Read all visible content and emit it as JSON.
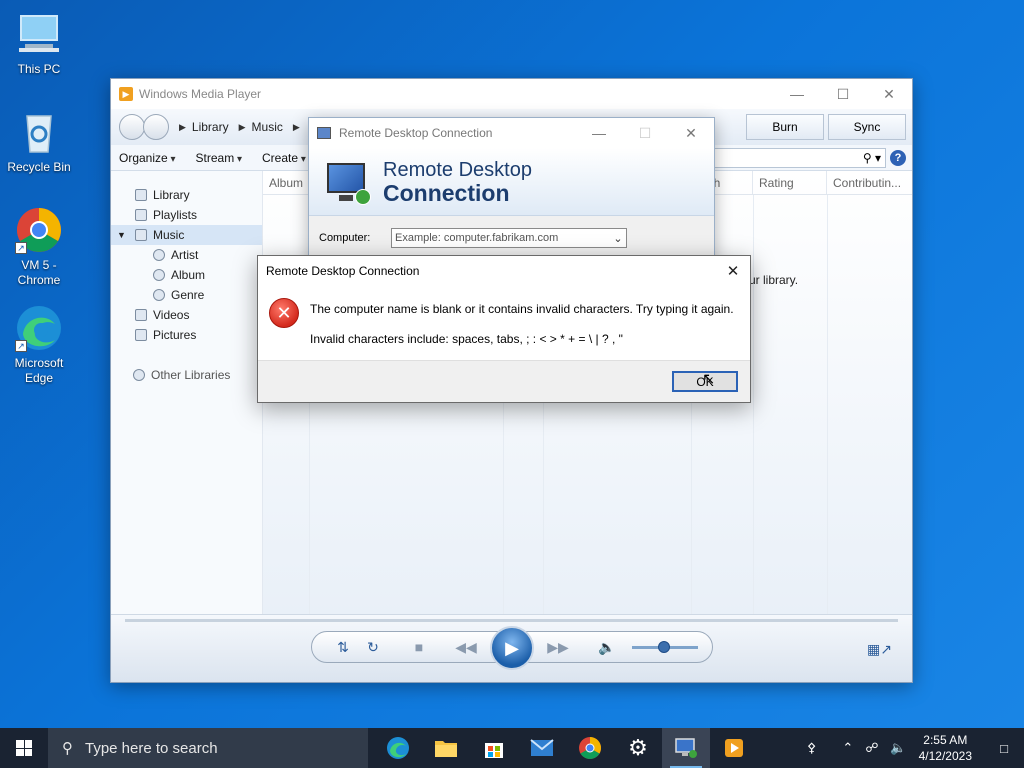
{
  "desktop": {
    "icons": [
      {
        "label": "This PC"
      },
      {
        "label": "Recycle Bin"
      },
      {
        "label": "VM 5 - Chrome"
      },
      {
        "label": "Microsoft Edge"
      }
    ]
  },
  "wmp": {
    "title": "Windows Media Player",
    "breadcrumb": [
      "Library",
      "Music"
    ],
    "top_buttons": [
      "Burn",
      "Sync"
    ],
    "toolbar": [
      "Organize",
      "Stream",
      "Create"
    ],
    "sidebar": [
      {
        "label": "Library"
      },
      {
        "label": "Playlists"
      },
      {
        "label": "Music"
      },
      {
        "label": "Artist"
      },
      {
        "label": "Album"
      },
      {
        "label": "Genre"
      },
      {
        "label": "Videos"
      },
      {
        "label": "Pictures"
      },
      {
        "label": "Other Libraries"
      }
    ],
    "columns": [
      "Album",
      "ngth",
      "Rating",
      "Contributin..."
    ],
    "library_msg": "ur library."
  },
  "rdc": {
    "title": "Remote Desktop Connection",
    "heading_line1": "Remote Desktop",
    "heading_line2": "Connection",
    "computer_label": "Computer:",
    "computer_placeholder": "Example: computer.fabrikam.com"
  },
  "error_dialog": {
    "title": "Remote Desktop Connection",
    "message": "The computer name is blank or it contains invalid characters. Try typing it again.",
    "detail": "Invalid characters include: spaces, tabs, ; : < > * + = \\ | ? , \"",
    "ok_label": "OK"
  },
  "taskbar": {
    "search_placeholder": "Type here to search",
    "time": "2:55 AM",
    "date": "4/12/2023"
  }
}
